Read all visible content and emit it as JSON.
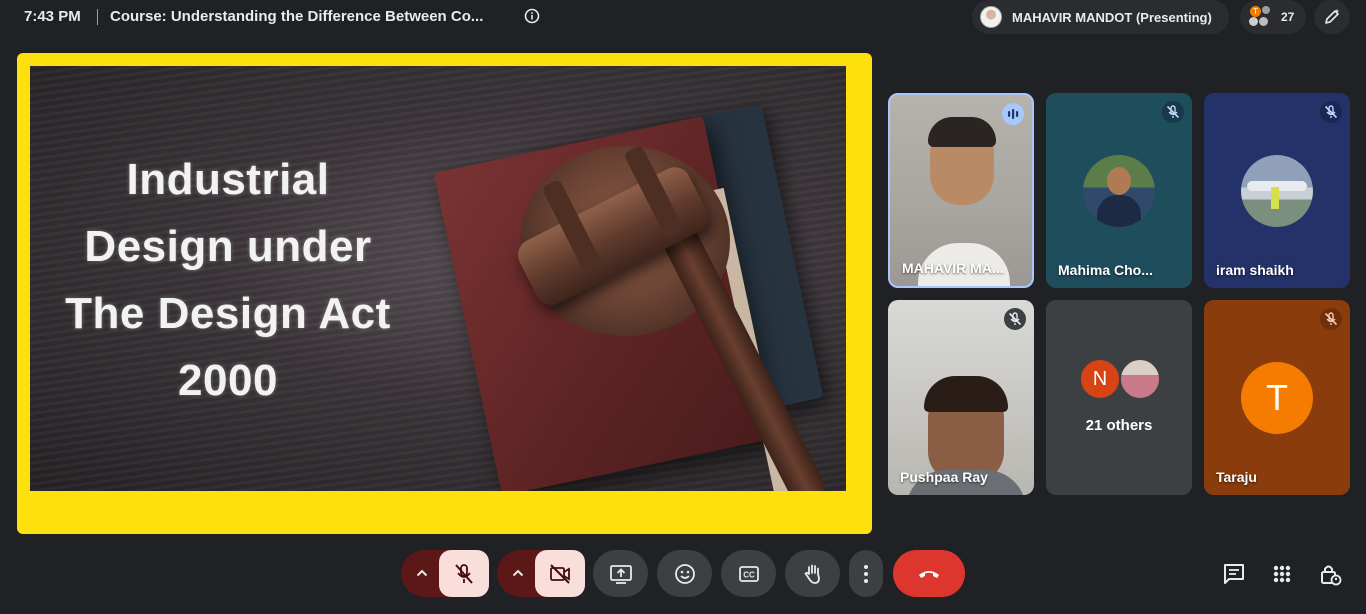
{
  "topbar": {
    "time": "7:43 PM",
    "meeting_title": "Course: Understanding the Difference Between Co...",
    "presenter": "MAHAVIR MANDOT (Presenting)",
    "participant_count": "27",
    "mini_avatar_letter": "T"
  },
  "slide": {
    "lines": [
      "Industrial",
      "Design under",
      "The Design Act",
      "2000"
    ]
  },
  "participants": [
    {
      "name": "MAHAVIR MA...",
      "status": "speaking"
    },
    {
      "name": "Mahima Cho...",
      "status": "muted"
    },
    {
      "name": "iram shaikh",
      "status": "muted"
    },
    {
      "name": "Pushpaa Ray",
      "status": "muted"
    },
    {
      "name": "21 others",
      "initial": "N"
    },
    {
      "name": "Taraju",
      "initial": "T",
      "status": "muted"
    }
  ],
  "colors": {
    "presentation_border": "#fee00c",
    "active_speaker_border": "#a8c7fa",
    "hangup": "#dc362e",
    "taraju_avatar": "#f57c00",
    "others_avatar_n": "#d84315"
  },
  "controls": [
    "mic-toggle",
    "camera-toggle",
    "present",
    "emoji",
    "captions",
    "raise-hand",
    "more-options",
    "leave-call"
  ]
}
